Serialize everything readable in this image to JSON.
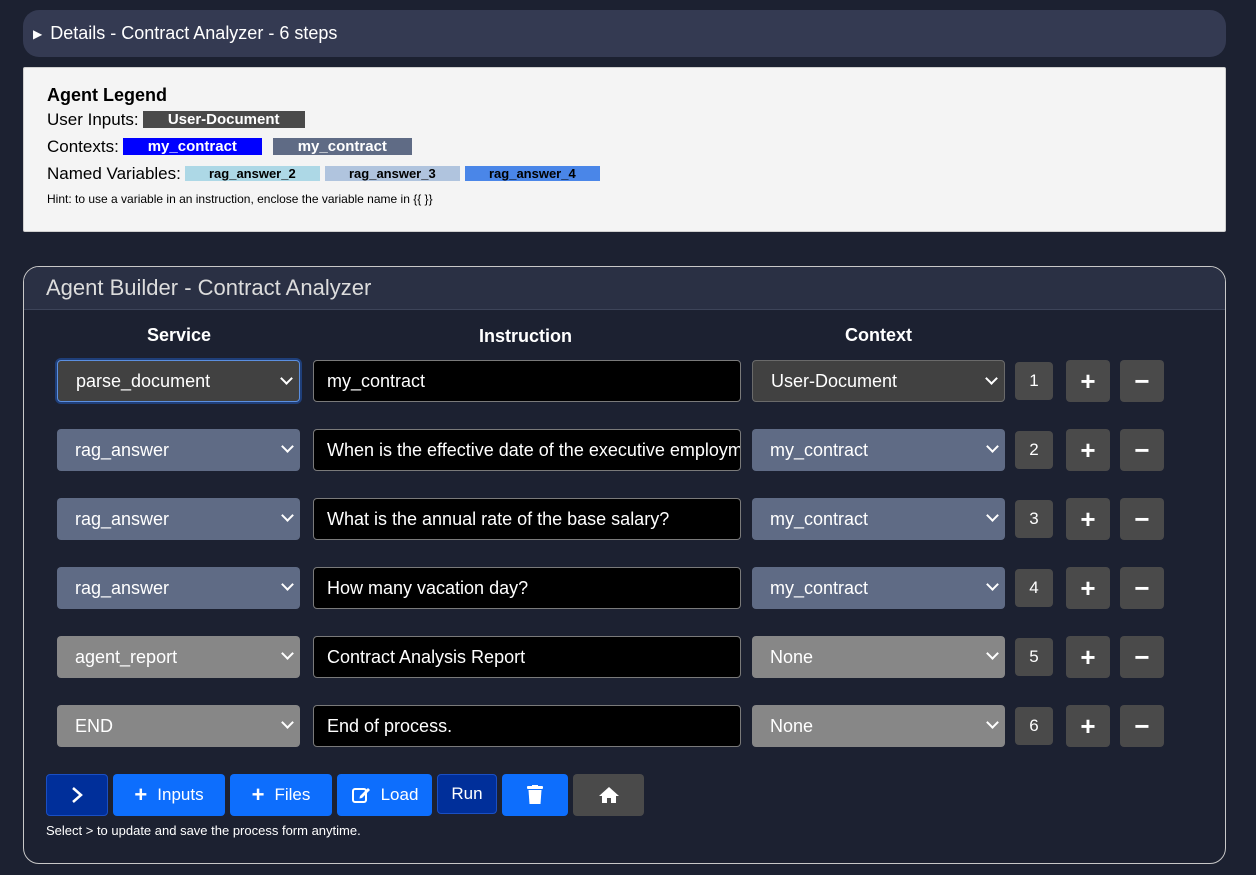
{
  "details": {
    "label": "Details - Contract Analyzer - 6 steps"
  },
  "legend": {
    "title": "Agent Legend",
    "user_inputs_label": "User Inputs:",
    "user_inputs": [
      "User-Document"
    ],
    "contexts_label": "Contexts:",
    "contexts": [
      "my_contract",
      "my_contract"
    ],
    "named_vars_label": "Named Variables:",
    "named_vars": [
      "rag_answer_2",
      "rag_answer_3",
      "rag_answer_4"
    ],
    "hint": "Hint: to use a variable in an instruction, enclose the variable name in {{ }}"
  },
  "builder": {
    "title": "Agent Builder - Contract Analyzer",
    "col_service": "Service",
    "col_instruction": "Instruction",
    "col_context": "Context",
    "steps": [
      {
        "service": "parse_document",
        "instruction": "my_contract",
        "context": "User-Document",
        "num": "1"
      },
      {
        "service": "rag_answer",
        "instruction": "When is the effective date of the executive employment agreement?",
        "context": "my_contract",
        "num": "2"
      },
      {
        "service": "rag_answer",
        "instruction": "What is the annual rate of the base salary?",
        "context": "my_contract",
        "num": "3"
      },
      {
        "service": "rag_answer",
        "instruction": "How many vacation day?",
        "context": "my_contract",
        "num": "4"
      },
      {
        "service": "agent_report",
        "instruction": "Contract Analysis Report",
        "context": "None",
        "num": "5"
      },
      {
        "service": "END",
        "instruction": "End of process.",
        "context": "None",
        "num": "6"
      }
    ],
    "plus": "+",
    "minus": "−",
    "buttons": {
      "next": ">",
      "inputs": "Inputs",
      "files": "Files",
      "load": "Load",
      "run": "Run"
    },
    "footer_hint": "Select > to update and save the process form anytime."
  },
  "colors": {
    "select_active": "#414141",
    "select_rag": "#5f6b85",
    "select_gray": "#878787",
    "var1": "#add8e6",
    "var2": "#b0c4de",
    "var3": "#4a86e8",
    "btn_dark_blue": "#002f9a",
    "btn_blue": "#0d6efd"
  }
}
